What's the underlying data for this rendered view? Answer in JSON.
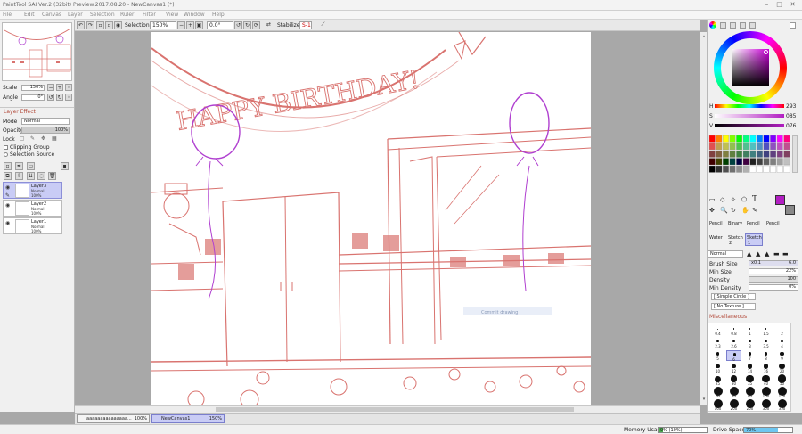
{
  "window": {
    "title": "PaintTool SAI Ver.2 (32bit) Preview.2017.08.20 - NewCanvas1 (*)"
  },
  "menu": [
    "File",
    "Edit",
    "Canvas",
    "Layer",
    "Selection",
    "Ruler",
    "Filter",
    "View",
    "Window",
    "Help"
  ],
  "toolbar": {
    "selection_label": "Selection",
    "zoom_value": "150%",
    "angle_value": "0.0°",
    "stabilizer_label": "Stabilizer",
    "stabilizer_value": "S-1"
  },
  "navigator": {
    "scale_label": "Scale",
    "scale_value": "150%",
    "angle_label": "Angle",
    "angle_value": "0°"
  },
  "layer_panel": {
    "effect_label": "Layer Effect",
    "mode_label": "Mode",
    "mode_value": "Normal",
    "opacity_label": "Opacity",
    "opacity_value": "100%",
    "lock_label": "Lock",
    "clipping_label": "Clipping Group",
    "selection_source_label": "Selection Source",
    "layers": [
      {
        "name": "Layer3",
        "mode": "Normal",
        "opacity": "100%",
        "selected": true
      },
      {
        "name": "Layer2",
        "mode": "Normal",
        "opacity": "100%",
        "selected": false
      },
      {
        "name": "Layer1",
        "mode": "Normal",
        "opacity": "100%",
        "selected": false
      }
    ]
  },
  "color_panel": {
    "h_label": "H",
    "h_value": "293",
    "s_label": "S",
    "s_value": "085",
    "v_label": "V",
    "v_value": "076",
    "current_color": "#b21fc2"
  },
  "tools": {
    "brush_tools": [
      {
        "label": "Pencil"
      },
      {
        "label": "Binary"
      },
      {
        "label": "Pencil"
      },
      {
        "label": "Pencil"
      },
      {
        "label": "Water"
      },
      {
        "label": "Sketch",
        "num": "2"
      },
      {
        "label": "Sketch",
        "num": "1"
      }
    ]
  },
  "brush_settings": {
    "blend_mode": "Normal",
    "brush_size_label": "Brush Size",
    "brush_size_mult": "x0.1",
    "brush_size_value": "6.0",
    "min_size_label": "Min Size",
    "min_size_value": "22%",
    "density_label": "Density",
    "density_value": "100",
    "min_density_label": "Min Density",
    "min_density_value": "0%",
    "shape": "[ Simple Circle ]",
    "texture": "[ No Texture ]",
    "misc_label": "Miscellaneous",
    "preset_sizes": [
      "0.4",
      "0.8",
      "1",
      "1.5",
      "2",
      "2.3",
      "2.6",
      "3",
      "3.5",
      "4",
      "5",
      "6",
      "7",
      "8",
      "9",
      "10",
      "12",
      "14",
      "16",
      "20",
      "25",
      "30",
      "35",
      "40",
      "50",
      "60",
      "70",
      "80",
      "100",
      "120",
      "160",
      "200",
      "250",
      "300",
      "350"
    ],
    "selected_preset": "6"
  },
  "tabs": [
    {
      "label": "aaaaaaaaaaaaaaa...",
      "zoom": "100%"
    },
    {
      "label": "NewCanvas1",
      "zoom": "150%"
    }
  ],
  "status": {
    "memory_label": "Memory Usage",
    "memory_value": "9% (10%)",
    "memory_fraction": 0.09,
    "drive_label": "Drive Space",
    "drive_value": "70%",
    "drive_fraction": 0.7
  },
  "canvas_text": {
    "banner": "HAPPY BIRTHDAY!",
    "hint": "Commit drawing"
  },
  "colors": {
    "sketch_red": "#d9736f",
    "sketch_purple": "#b040d0",
    "selected_layer": "#c9ccf5"
  }
}
